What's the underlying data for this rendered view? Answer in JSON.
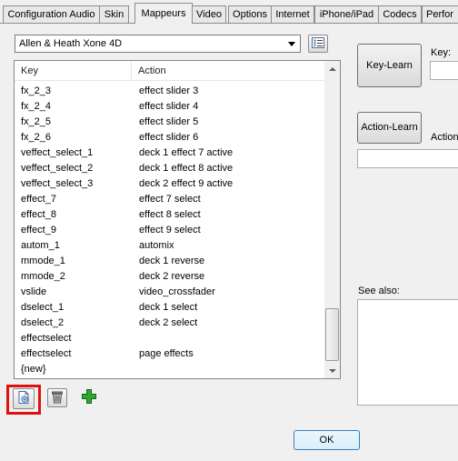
{
  "tabs": [
    {
      "label": "Configuration Audio",
      "active": false
    },
    {
      "label": "Skin",
      "active": false
    },
    {
      "label": "Mappeurs",
      "active": true
    },
    {
      "label": "Video",
      "active": false
    },
    {
      "label": "Options",
      "active": false
    },
    {
      "label": "Internet",
      "active": false
    },
    {
      "label": "iPhone/iPad",
      "active": false
    },
    {
      "label": "Codecs",
      "active": false
    },
    {
      "label": "Perfor",
      "active": false
    }
  ],
  "mapper_select": {
    "value": "Allen & Heath Xone 4D"
  },
  "list": {
    "columns": {
      "key": "Key",
      "action": "Action"
    },
    "rows": [
      {
        "key": "fx_2_3",
        "action": "effect slider 3"
      },
      {
        "key": "fx_2_4",
        "action": "effect slider 4"
      },
      {
        "key": "fx_2_5",
        "action": "effect slider 5"
      },
      {
        "key": "fx_2_6",
        "action": "effect slider 6"
      },
      {
        "key": "veffect_select_1",
        "action": "deck 1 effect 7 active"
      },
      {
        "key": "veffect_select_2",
        "action": "deck 1 effect 8 active"
      },
      {
        "key": "veffect_select_3",
        "action": "deck 2 effect 9 active"
      },
      {
        "key": "effect_7",
        "action": "effect 7 select"
      },
      {
        "key": "effect_8",
        "action": "effect 8 select"
      },
      {
        "key": "effect_9",
        "action": "effect 9 select"
      },
      {
        "key": "autom_1",
        "action": "automix"
      },
      {
        "key": "mmode_1",
        "action": "deck 1 reverse"
      },
      {
        "key": "mmode_2",
        "action": "deck 2 reverse"
      },
      {
        "key": "vslide",
        "action": "video_crossfader"
      },
      {
        "key": "dselect_1",
        "action": "deck 1 select"
      },
      {
        "key": "dselect_2",
        "action": "deck 2 select"
      },
      {
        "key": "effectselect",
        "action": ""
      },
      {
        "key": "effectselect",
        "action": "page effects"
      },
      {
        "key": "{new}",
        "action": ""
      }
    ]
  },
  "right_panel": {
    "key_learn_label": "Key-Learn",
    "key_label": "Key:",
    "action_learn_label": "Action-Learn",
    "action_label": "Action",
    "see_also_label": "See also:"
  },
  "icons": {
    "mapper_options": "list-options-icon",
    "new_mapping": "new-document-icon",
    "delete": "trash-icon",
    "add": "plus-icon",
    "add_color": "#2a9a2a",
    "selection_color": "#e01010"
  },
  "ok_label": "OK"
}
